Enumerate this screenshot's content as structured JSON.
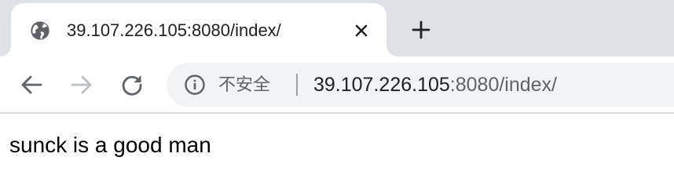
{
  "tab": {
    "title": "39.107.226.105:8080/index/",
    "favicon": "globe-icon",
    "close_icon": "close-icon"
  },
  "new_tab_icon": "plus-icon",
  "toolbar": {
    "back_icon": "arrow-left-icon",
    "forward_icon": "arrow-right-icon",
    "reload_icon": "reload-icon"
  },
  "omnibox": {
    "security_icon": "info-icon",
    "security_label": "不安全",
    "url_host": "39.107.226.105",
    "url_rest": ":8080/index/"
  },
  "page": {
    "text": "sunck is a good man"
  },
  "colors": {
    "tabstrip_bg": "#dee1e6",
    "omnibox_bg": "#f1f3f4",
    "text_primary": "#202124",
    "text_secondary": "#5f6368",
    "icon_disabled": "#bdc1c6"
  }
}
